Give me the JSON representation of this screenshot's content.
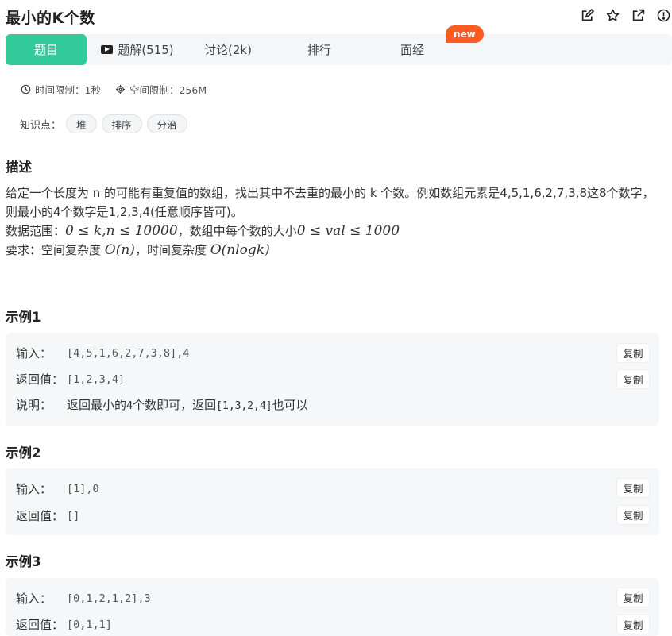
{
  "header": {
    "title": "最小的K个数",
    "icons": [
      "edit-icon",
      "star-icon",
      "external-link-icon",
      "info-icon"
    ]
  },
  "tabs": [
    {
      "label": "题目",
      "active": true
    },
    {
      "label": "题解(515)",
      "icon": "video-icon"
    },
    {
      "label": "讨论(2k)"
    },
    {
      "label": "排行"
    },
    {
      "label": "面经"
    }
  ],
  "badge": "new",
  "limits": {
    "time": "时间限制：1秒",
    "space": "空间限制：256M"
  },
  "tags": {
    "label": "知识点：",
    "items": [
      "堆",
      "排序",
      "分治"
    ]
  },
  "description": {
    "title": "描述",
    "line1": "给定一个长度为 n 的可能有重复值的数组，找出其中不去重的最小的 k 个数。例如数组元素是4,5,1,6,2,7,3,8这8个数字，则最小的4个数字是1,2,3,4(任意顺序皆可)。",
    "range_prefix": "数据范围：",
    "range_math1": "0 ≤ k,n ≤ 10000",
    "range_mid": "，数组中每个数的大小",
    "range_math2": "0 ≤ val ≤ 1000",
    "req_prefix": "要求：空间复杂度 ",
    "req_math1": "O(n)",
    "req_mid": "，时间复杂度 ",
    "req_math2": "O(nlogk)"
  },
  "examples": [
    {
      "title": "示例1",
      "input_label": "输入：",
      "input": "[4,5,1,6,2,7,3,8],4",
      "output_label": "返回值：",
      "output": "[1,2,3,4]",
      "note_label": "说明：",
      "note_a": "返回最小的",
      "note_b": "4",
      "note_c": "个数即可，返回",
      "note_d": "[1,3,2,4]",
      "note_e": "也可以"
    },
    {
      "title": "示例2",
      "input_label": "输入：",
      "input": "[1],0",
      "output_label": "返回值：",
      "output": "[]"
    },
    {
      "title": "示例3",
      "input_label": "输入：",
      "input": "[0,1,2,1,2],3",
      "output_label": "返回值：",
      "output": "[0,1,1]"
    }
  ],
  "copy_label": "复制",
  "colors": {
    "accent": "#32ca99",
    "badge": "#ff5a1f",
    "panel": "#f6f7f9"
  }
}
